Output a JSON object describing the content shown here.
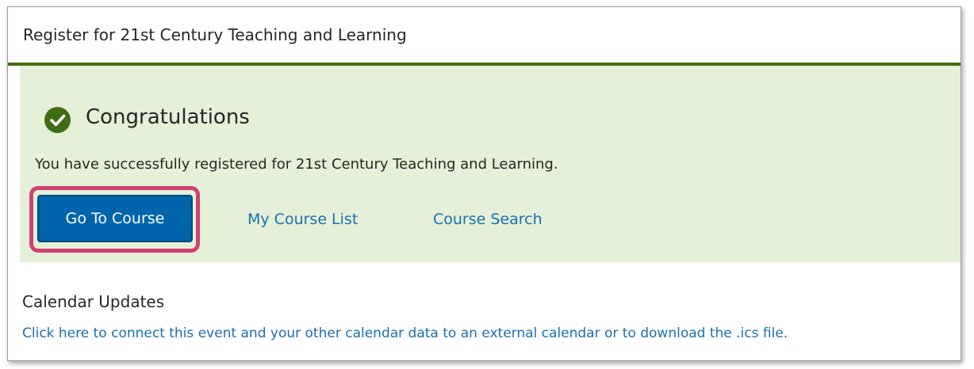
{
  "header": {
    "title": "Register for 21st Century Teaching and Learning"
  },
  "success": {
    "icon": "checkmark-circle-icon",
    "heading": "Congratulations",
    "message": "You have successfully registered for 21st Century Teaching and Learning.",
    "go_to_course_label": "Go To Course",
    "my_course_list_label": "My Course List",
    "course_search_label": "Course Search"
  },
  "calendar": {
    "title": "Calendar Updates",
    "link_text": "Click here to connect this event and your other calendar data to an external calendar or to download the .ics file."
  },
  "colors": {
    "accent_green": "#3f6e12",
    "panel_background": "#e5f0d8",
    "button_blue": "#0065aa",
    "link_blue": "#1a6fb0",
    "highlight_pink": "#d0416f"
  }
}
